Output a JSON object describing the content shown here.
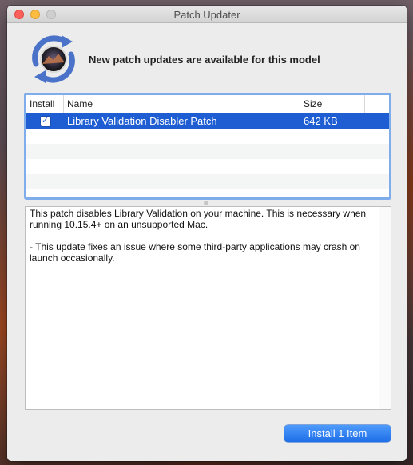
{
  "window": {
    "title": "Patch Updater"
  },
  "header": {
    "icon": "macos-patcher-app-icon",
    "message": "New patch updates are available for this model"
  },
  "table": {
    "columns": [
      "Install",
      "Name",
      "Size"
    ],
    "rows": [
      {
        "install": true,
        "name": "Library Validation Disabler Patch",
        "size": "642 KB"
      }
    ]
  },
  "description": {
    "paragraph1": "This patch disables Library Validation on your machine. This is necessary when running 10.15.4+ on an unsupported Mac.",
    "paragraph2": "- This update fixes an issue where some third-party applications may crash on launch occasionally."
  },
  "actions": {
    "install_label": "Install 1 Item"
  },
  "colors": {
    "accent": "#1e5ed2",
    "button": "#2a7cf0",
    "close": "#fc605b",
    "minimize": "#fdbc40"
  }
}
